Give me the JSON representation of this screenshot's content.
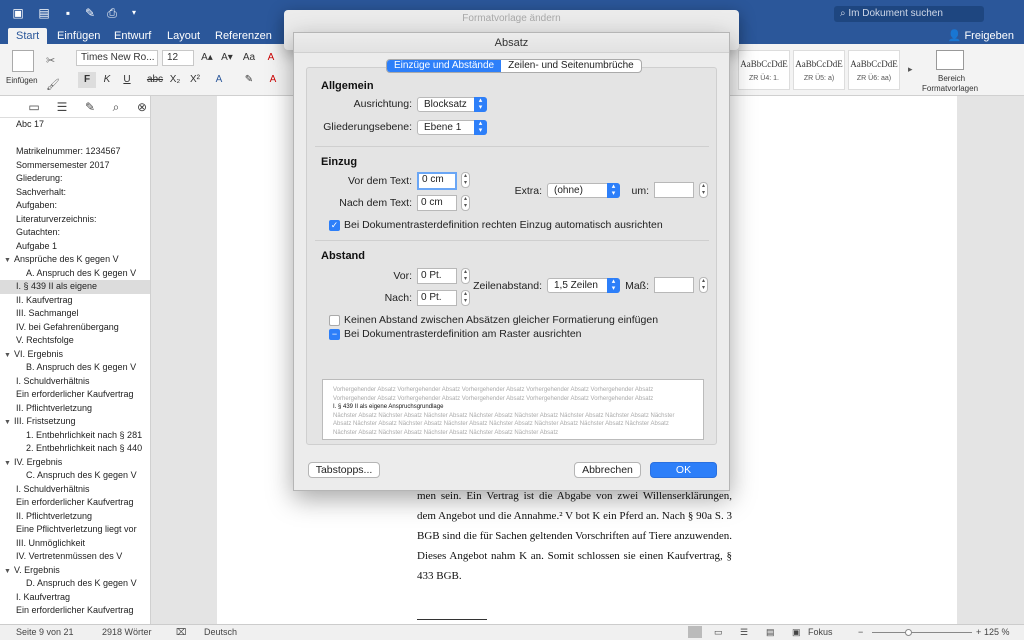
{
  "title_bar": {
    "search_placeholder": "Im Dokument suchen"
  },
  "tabs": [
    "Start",
    "Einfügen",
    "Entwurf",
    "Layout",
    "Referenzen"
  ],
  "share_label": "Freigeben",
  "ribbon": {
    "paste_label": "Einfügen",
    "font_name": "Times New Ro...",
    "font_size": "12",
    "styles": [
      {
        "preview": "AaBbCcDdE",
        "name": "ZR Ü4: 1."
      },
      {
        "preview": "AaBbCcDdE",
        "name": "ZR Ü5: a)"
      },
      {
        "preview": "AaBbCcDdE",
        "name": "ZR Ü6: aa)"
      }
    ],
    "styles_pane_label_1": "Bereich",
    "styles_pane_label_2": "Formatvorlagen"
  },
  "sidebar": {
    "items": [
      {
        "text": "Abc 17",
        "indent": 0,
        "tri": ""
      },
      {
        "text": "",
        "indent": 0,
        "tri": ""
      },
      {
        "text": "Matrikelnummer: 1234567",
        "indent": 0,
        "tri": ""
      },
      {
        "text": "Sommersemester 2017",
        "indent": 0,
        "tri": ""
      },
      {
        "text": "Gliederung:",
        "indent": 0,
        "tri": ""
      },
      {
        "text": "Sachverhalt:",
        "indent": 0,
        "tri": ""
      },
      {
        "text": "Aufgaben:",
        "indent": 0,
        "tri": ""
      },
      {
        "text": "Literaturverzeichnis:",
        "indent": 0,
        "tri": ""
      },
      {
        "text": "Gutachten:",
        "indent": 0,
        "tri": ""
      },
      {
        "text": "Aufgabe 1",
        "indent": 0,
        "tri": ""
      },
      {
        "text": "Ansprüche des K gegen V",
        "indent": 0,
        "tri": "▼"
      },
      {
        "text": "A. Anspruch des K gegen V",
        "indent": 2,
        "tri": ""
      },
      {
        "text": "I. § 439 II als eigene",
        "indent": 0,
        "tri": "",
        "selected": true
      },
      {
        "text": "II. Kaufvertrag",
        "indent": 0,
        "tri": ""
      },
      {
        "text": "III. Sachmangel",
        "indent": 0,
        "tri": ""
      },
      {
        "text": "IV. bei Gefahrenübergang",
        "indent": 0,
        "tri": ""
      },
      {
        "text": "V. Rechtsfolge",
        "indent": 0,
        "tri": ""
      },
      {
        "text": "VI. Ergebnis",
        "indent": 0,
        "tri": "▼"
      },
      {
        "text": "B. Anspruch des K gegen V",
        "indent": 2,
        "tri": ""
      },
      {
        "text": "I. Schuldverhältnis",
        "indent": 0,
        "tri": ""
      },
      {
        "text": "Ein erforderlicher Kaufvertrag",
        "indent": 0,
        "tri": ""
      },
      {
        "text": "II. Pflichtverletzung",
        "indent": 0,
        "tri": ""
      },
      {
        "text": "III. Fristsetzung",
        "indent": 0,
        "tri": "▼"
      },
      {
        "text": "1. Entbehrlichkeit nach § 281",
        "indent": 2,
        "tri": ""
      },
      {
        "text": "2. Entbehrlichkeit nach § 440",
        "indent": 2,
        "tri": ""
      },
      {
        "text": "IV. Ergebnis",
        "indent": 0,
        "tri": "▼"
      },
      {
        "text": "C. Anspruch des K gegen V",
        "indent": 2,
        "tri": ""
      },
      {
        "text": "I. Schuldverhältnis",
        "indent": 0,
        "tri": ""
      },
      {
        "text": "Ein erforderlicher Kaufvertrag",
        "indent": 0,
        "tri": ""
      },
      {
        "text": "II. Pflichtverletzung",
        "indent": 0,
        "tri": ""
      },
      {
        "text": "Eine Pflichtverletzung liegt vor",
        "indent": 0,
        "tri": ""
      },
      {
        "text": "III. Unmöglichkeit",
        "indent": 0,
        "tri": ""
      },
      {
        "text": "IV. Vertretenmüssen des V",
        "indent": 0,
        "tri": ""
      },
      {
        "text": "V. Ergebnis",
        "indent": 0,
        "tri": "▼"
      },
      {
        "text": "D. Anspruch des K gegen V",
        "indent": 2,
        "tri": ""
      },
      {
        "text": "I. Kaufvertrag",
        "indent": 0,
        "tri": ""
      },
      {
        "text": "Ein erforderlicher Kaufvertrag",
        "indent": 0,
        "tri": ""
      }
    ]
  },
  "document": {
    "text": "men sein. Ein Vertrag ist die Abgabe von zwei Willenserklärungen, dem Angebot und die Annahme.² V bot K ein Pferd an. Nach § 90a S. 3 BGB sind die für Sachen geltenden Vorschriften auf Tiere anzuwenden. Dieses Angebot nahm K an. Somit schlossen sie einen Kaufvertrag, § 433 BGB."
  },
  "statusbar": {
    "page": "Seite 9 von 21",
    "words": "2918 Wörter",
    "language": "Deutsch",
    "focus": "Fokus",
    "zoom": "125 %"
  },
  "outer_dialog": {
    "title": "Formatvorlage ändern"
  },
  "dialog": {
    "title": "Absatz",
    "tabs": [
      "Einzüge und Abstände",
      "Zeilen- und Seitenumbrüche"
    ],
    "allgemein": {
      "title": "Allgemein",
      "alignment_label": "Ausrichtung:",
      "alignment_value": "Blocksatz",
      "outline_label": "Gliederungsebene:",
      "outline_value": "Ebene 1"
    },
    "einzug": {
      "title": "Einzug",
      "before_label": "Vor dem Text:",
      "before_value": "0 cm",
      "after_label": "Nach dem Text:",
      "after_value": "0 cm",
      "extra_label": "Extra:",
      "extra_value": "(ohne)",
      "by_label": "um:",
      "by_value": "",
      "auto_right_label": "Bei Dokumentrasterdefinition rechten Einzug automatisch ausrichten",
      "auto_right_checked": true
    },
    "abstand": {
      "title": "Abstand",
      "before_label": "Vor:",
      "before_value": "0 Pt.",
      "after_label": "Nach:",
      "after_value": "0 Pt.",
      "line_label": "Zeilenabstand:",
      "line_value": "1,5 Zeilen",
      "measure_label": "Maß:",
      "measure_value": "",
      "no_space_label": "Keinen Abstand zwischen Absätzen gleicher Formatierung einfügen",
      "no_space_checked": false,
      "grid_label": "Bei Dokumentrasterdefinition am Raster ausrichten",
      "grid_state": "mixed"
    },
    "preview": {
      "prev": "Vorhergehender Absatz Vorhergehender Absatz Vorhergehender Absatz Vorhergehender Absatz Vorhergehender Absatz Vorhergehender Absatz Vorhergehender Absatz Vorhergehender Absatz Vorhergehender Absatz Vorhergehender Absatz",
      "current": "I. § 439 II als eigene Anspruchsgrundlage",
      "next": "Nächster Absatz Nächster Absatz Nächster Absatz Nächster Absatz Nächster Absatz Nächster Absatz Nächster Absatz Nächster Absatz Nächster Absatz Nächster Absatz Nächster Absatz Nächster Absatz Nächster Absatz Nächster Absatz Nächster Absatz Nächster Absatz Nächster Absatz Nächster Absatz Nächster Absatz Nächster Absatz"
    },
    "buttons": {
      "tabs": "Tabstopps...",
      "cancel": "Abbrechen",
      "ok": "OK"
    }
  }
}
